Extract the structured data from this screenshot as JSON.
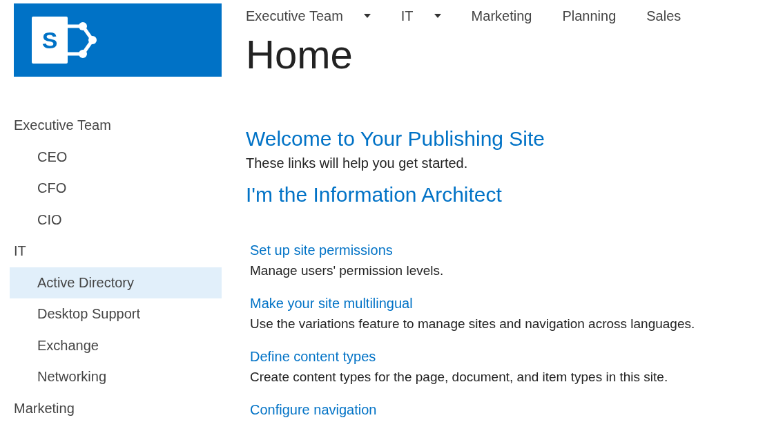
{
  "logo": {
    "letter": "S"
  },
  "top_nav": [
    {
      "label": "Executive Team",
      "has_menu": true
    },
    {
      "label": "IT",
      "has_menu": true
    },
    {
      "label": "Marketing",
      "has_menu": false
    },
    {
      "label": "Planning",
      "has_menu": false
    },
    {
      "label": "Sales",
      "has_menu": false
    }
  ],
  "page_title": "Home",
  "quick_launch": [
    {
      "label": "Executive Team",
      "selected": false,
      "children": [
        {
          "label": "CEO",
          "selected": false
        },
        {
          "label": "CFO",
          "selected": false
        },
        {
          "label": "CIO",
          "selected": false
        }
      ]
    },
    {
      "label": "IT",
      "selected": false,
      "children": [
        {
          "label": "Active Directory",
          "selected": true
        },
        {
          "label": "Desktop Support",
          "selected": false
        },
        {
          "label": "Exchange",
          "selected": false
        },
        {
          "label": "Networking",
          "selected": false
        }
      ]
    },
    {
      "label": "Marketing",
      "selected": false
    }
  ],
  "welcome": {
    "heading": "Welcome to Your Publishing Site",
    "subtitle": "These links will help you get started.",
    "role_heading": "I'm the Information Architect"
  },
  "tasks": [
    {
      "link": "Set up site permissions",
      "description": "Manage users' permission levels."
    },
    {
      "link": "Make your site multilingual",
      "description": "Use the variations feature to manage sites and navigation across languages."
    },
    {
      "link": "Define content types",
      "description": "Create content types for the page, document, and item types in this site."
    },
    {
      "link": "Configure navigation"
    }
  ]
}
